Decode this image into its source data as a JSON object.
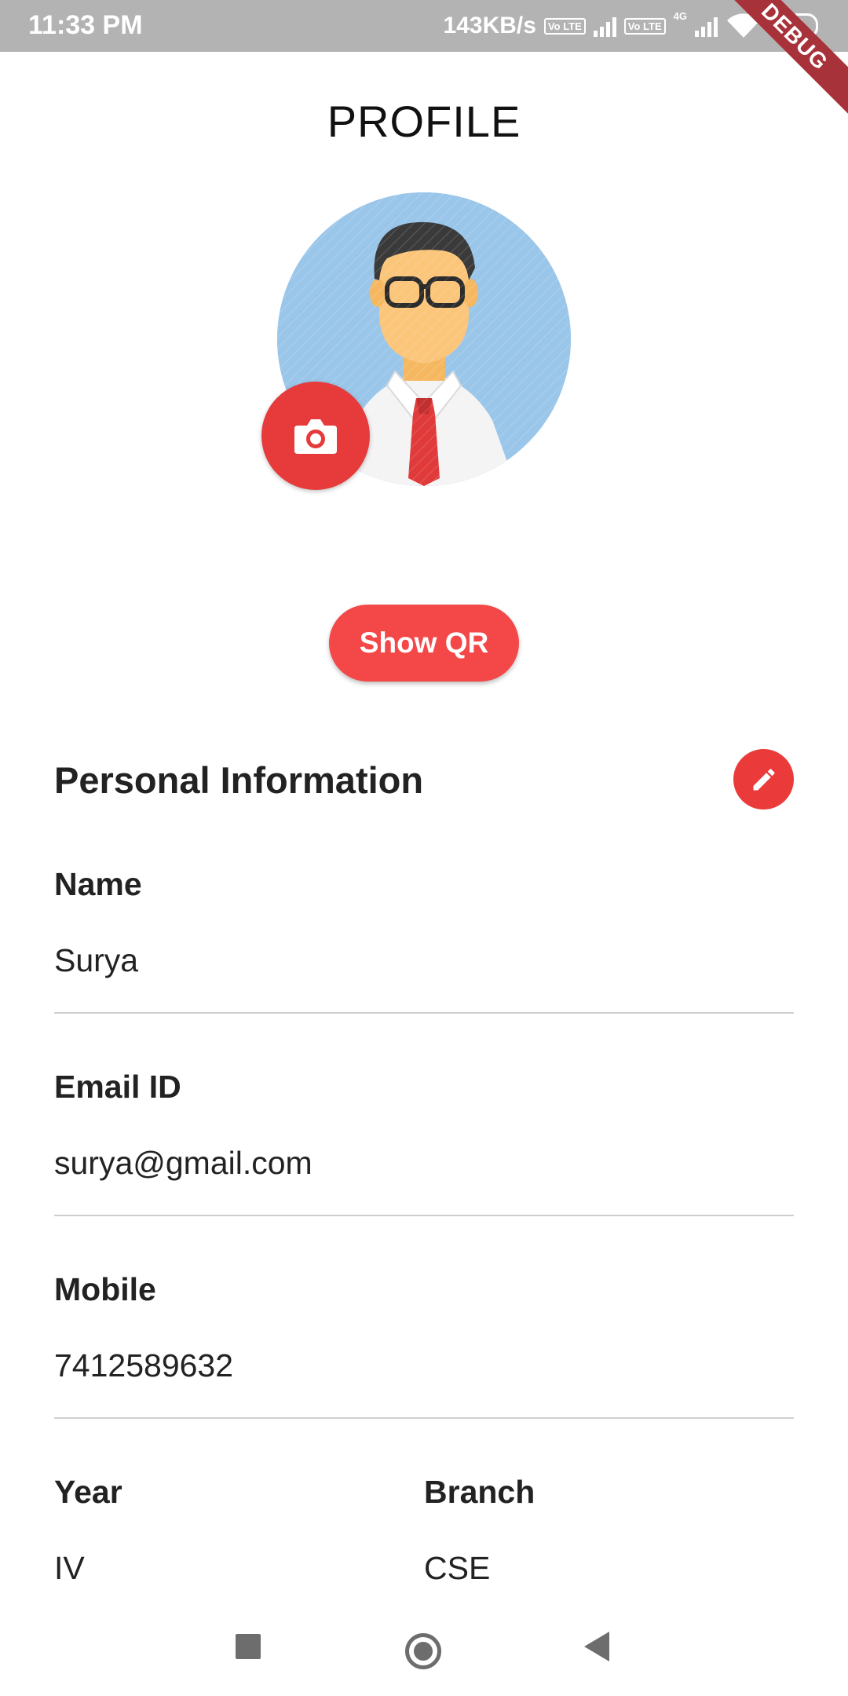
{
  "status_bar": {
    "time": "11:33 PM",
    "network_speed": "143KB/s",
    "volte_1": "Vo LTE",
    "volte_2": "Vo LTE",
    "network_type": "4G",
    "battery": "27"
  },
  "debug_banner": "DEBUG",
  "header": {
    "title": "PROFILE"
  },
  "avatar": {
    "icon": "person-avatar-icon"
  },
  "camera_button": {
    "icon": "camera-icon"
  },
  "qr_button": {
    "label": "Show QR"
  },
  "section": {
    "title": "Personal Information",
    "edit_icon": "pencil-icon"
  },
  "fields": {
    "name": {
      "label": "Name",
      "value": "Surya"
    },
    "email": {
      "label": "Email ID",
      "value": "surya@gmail.com"
    },
    "mobile": {
      "label": "Mobile",
      "value": "7412589632"
    },
    "year": {
      "label": "Year",
      "value": "IV"
    },
    "branch": {
      "label": "Branch",
      "value": "CSE"
    }
  },
  "colors": {
    "accent": "#F44848",
    "avatar_bg": "#9AC6EA",
    "status_bar": "#B3B3B3",
    "debug_ribbon": "#A8323A"
  }
}
